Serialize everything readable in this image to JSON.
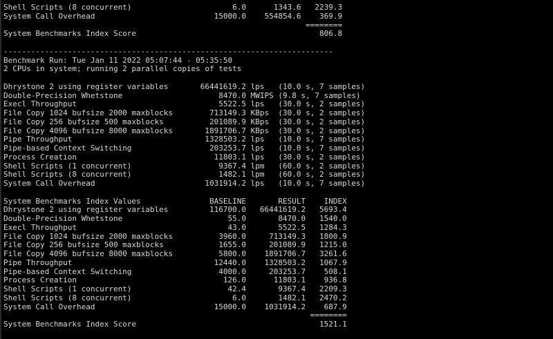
{
  "terminal": {
    "lines": [
      "Shell Scripts (8 concurrent)                      6.0      1343.6   2239.3",
      "System Call Overhead                          15000.0    554854.6    369.9",
      "                                                                  ========",
      "System Benchmarks Index Score                                        806.8",
      "",
      "------------------------------------------------------------------------",
      "Benchmark Run: Tue Jan 11 2022 05:07:44 - 05:35:50",
      "2 CPUs in system; running 2 parallel copies of tests",
      "",
      "Dhrystone 2 using register variables       66441619.2 lps   (10.0 s, 7 samples)",
      "Double-Precision Whetstone                     8470.0 MWIPS (9.8 s, 7 samples)",
      "Execl Throughput                               5522.5 lps   (30.0 s, 2 samples)",
      "File Copy 1024 bufsize 2000 maxblocks        713149.3 KBps  (30.0 s, 2 samples)",
      "File Copy 256 bufsize 500 maxblocks          201089.9 KBps  (30.0 s, 2 samples)",
      "File Copy 4096 bufsize 8000 maxblocks       1891706.7 KBps  (30.0 s, 2 samples)",
      "Pipe Throughput                             1328503.2 lps   (10.0 s, 7 samples)",
      "Pipe-based Context Switching                 203253.7 lps   (10.0 s, 7 samples)",
      "Process Creation                              11803.1 lps   (30.0 s, 2 samples)",
      "Shell Scripts (1 concurrent)                   9367.4 lpm   (60.0 s, 2 samples)",
      "Shell Scripts (8 concurrent)                   1482.1 lpm   (60.0 s, 2 samples)",
      "System Call Overhead                        1031914.2 lps   (10.0 s, 7 samples)",
      "",
      "System Benchmarks Index Values               BASELINE       RESULT    INDEX",
      "Dhrystone 2 using register variables         116700.0   66441619.2   5693.4",
      "Double-Precision Whetstone                       55.0       8470.0   1540.0",
      "Execl Throughput                                 43.0       5522.5   1284.3",
      "File Copy 1024 bufsize 2000 maxblocks          3960.0     713149.3   1800.9",
      "File Copy 256 bufsize 500 maxblocks            1655.0     201089.9   1215.0",
      "File Copy 4096 bufsize 8000 maxblocks          5800.0    1891706.7   3261.6",
      "Pipe Throughput                               12440.0    1328503.2   1067.9",
      "Pipe-based Context Switching                   4000.0     203253.7    508.1",
      "Process Creation                                126.0      11803.1    936.8",
      "Shell Scripts (1 concurrent)                     42.4       9367.4   2209.3",
      "Shell Scripts (8 concurrent)                      6.0       1482.1   2470.2",
      "System Call Overhead                          15000.0    1031914.2    687.9",
      "                                                                   ========",
      "System Benchmarks Index Score                                        1521.1"
    ]
  },
  "colors": {
    "background": "#000000",
    "text": "#d6d6d6"
  }
}
